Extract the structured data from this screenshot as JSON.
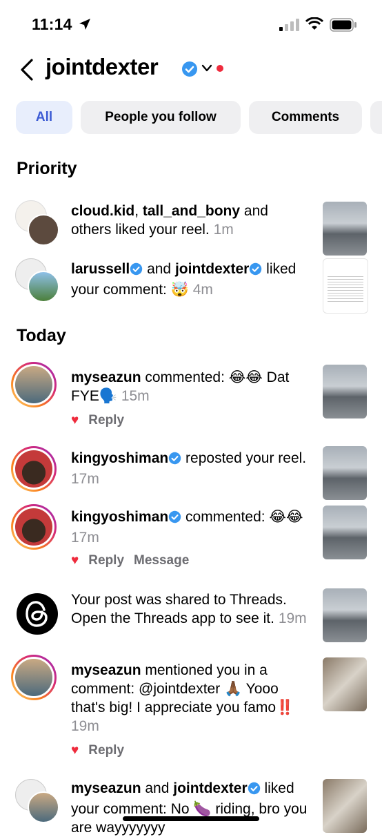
{
  "status_bar": {
    "time": "11:14"
  },
  "header": {
    "username": "jointdexter"
  },
  "filters": [
    "All",
    "People you follow",
    "Comments"
  ],
  "sections": {
    "priority": "Priority",
    "today": "Today"
  },
  "notifications": [
    {
      "parts": [
        [
          "b",
          "cloud.kid"
        ],
        [
          "t",
          ", "
        ],
        [
          "b",
          "tall_and_bony"
        ],
        [
          "t",
          " and others liked your reel. "
        ],
        [
          "g",
          "1m"
        ]
      ]
    },
    {
      "parts": [
        [
          "b",
          "larussell"
        ],
        [
          "v",
          ""
        ],
        [
          "t",
          " and "
        ],
        [
          "b",
          "jointdexter"
        ],
        [
          "v",
          ""
        ],
        [
          "t",
          " liked your comment: 🤯 "
        ],
        [
          "g",
          "4m"
        ]
      ]
    },
    {
      "parts": [
        [
          "b",
          "myseazun"
        ],
        [
          "t",
          " commented: 😂😂 Dat FYE🗣️ "
        ],
        [
          "g",
          "15m"
        ]
      ]
    },
    {
      "parts": [
        [
          "b",
          "kingyoshiman"
        ],
        [
          "v",
          ""
        ],
        [
          "t",
          " reposted your reel. "
        ],
        [
          "g",
          "17m"
        ]
      ]
    },
    {
      "parts": [
        [
          "b",
          "kingyoshiman"
        ],
        [
          "v",
          ""
        ],
        [
          "t",
          " commented: 😂😂 "
        ],
        [
          "g",
          "17m"
        ]
      ]
    },
    {
      "parts": [
        [
          "t",
          "Your post was shared to Threads. Open the Threads app to see it. "
        ],
        [
          "g",
          "19m"
        ]
      ]
    },
    {
      "parts": [
        [
          "b",
          "myseazun"
        ],
        [
          "t",
          " mentioned you in a comment: @jointdexter 🙏🏾 Yooo that's big! I appreciate you famo‼️ "
        ],
        [
          "g",
          "19m"
        ]
      ]
    },
    {
      "parts": [
        [
          "b",
          "myseazun"
        ],
        [
          "t",
          " and "
        ],
        [
          "b",
          "jointdexter"
        ],
        [
          "v",
          ""
        ],
        [
          "t",
          " liked your comment: No 🍆 riding, bro you are wayyyyyyy"
        ]
      ]
    }
  ],
  "actions": {
    "reply": "Reply",
    "message": "Message"
  },
  "colors": {
    "accent": "#3c5bd4",
    "verified": "#3897f0",
    "like": "#ef2b3d",
    "unread": "#ef2b3d",
    "muted": "#8e8e93"
  }
}
